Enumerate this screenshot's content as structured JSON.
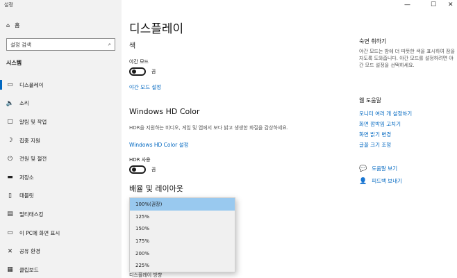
{
  "app": {
    "title": "설정"
  },
  "window_controls": {
    "minimize": "—",
    "maximize": "☐",
    "close": "✕"
  },
  "sidebar": {
    "home_label": "홈",
    "search_placeholder": "설정 검색",
    "section": "시스템",
    "items": [
      {
        "label": "디스플레이",
        "icon": "monitor-icon",
        "glyph": "▭",
        "active": true
      },
      {
        "label": "소리",
        "icon": "speaker-icon",
        "glyph": "🔈",
        "active": false
      },
      {
        "label": "알림 및 작업",
        "icon": "notification-icon",
        "glyph": "▢",
        "active": false
      },
      {
        "label": "집중 지원",
        "icon": "moon-icon",
        "glyph": "☽",
        "active": false
      },
      {
        "label": "전원 및 절전",
        "icon": "power-icon",
        "glyph": "⏻",
        "active": false
      },
      {
        "label": "저장소",
        "icon": "storage-icon",
        "glyph": "▬",
        "active": false
      },
      {
        "label": "태블릿",
        "icon": "tablet-icon",
        "glyph": "▯",
        "active": false
      },
      {
        "label": "멀티태스킹",
        "icon": "multitask-icon",
        "glyph": "▤",
        "active": false
      },
      {
        "label": "이 PC에 화면 표시",
        "icon": "project-icon",
        "glyph": "▭",
        "active": false
      },
      {
        "label": "공유 환경",
        "icon": "share-icon",
        "glyph": "✕",
        "active": false
      },
      {
        "label": "클립보드",
        "icon": "clipboard-icon",
        "glyph": "▦",
        "active": false
      }
    ]
  },
  "main": {
    "title": "디스플레이",
    "color_section": "색",
    "night_mode_label": "야간 모드",
    "night_mode_state": "끔",
    "night_mode_link": "야간 모드 설정",
    "hd_section": "Windows HD Color",
    "hd_desc": "HDR을 지원하는 비디오, 게임 및 앱에서 보다 밝고 생생한 화질을 감상하세요.",
    "hd_link": "Windows HD Color 설정",
    "hdr_label": "HDR 사용",
    "hdr_state": "끔",
    "scale_section": "배율 및 레이아웃",
    "scale_options": [
      "100%(권장)",
      "125%",
      "150%",
      "175%",
      "200%",
      "225%"
    ],
    "selected_index": 0,
    "under_text": "디스플레이 방향"
  },
  "right": {
    "sleep_head": "숙면 취하기",
    "sleep_desc": "야간 모드는 밤에 더 따뜻한 색을 표시하여 잠을 자도록 도와줍니다. 야간 모드를 설정하려면 야간 모드 설정을 선택하세요.",
    "help_head": "웹 도움말",
    "links": [
      "모니터 여러 개 설정하기",
      "화면 깜박임 고치기",
      "화면 밝기 변경",
      "글꼴 크기 조정"
    ],
    "help_link": "도움말 보기",
    "feedback_link": "피드백 보내기"
  }
}
